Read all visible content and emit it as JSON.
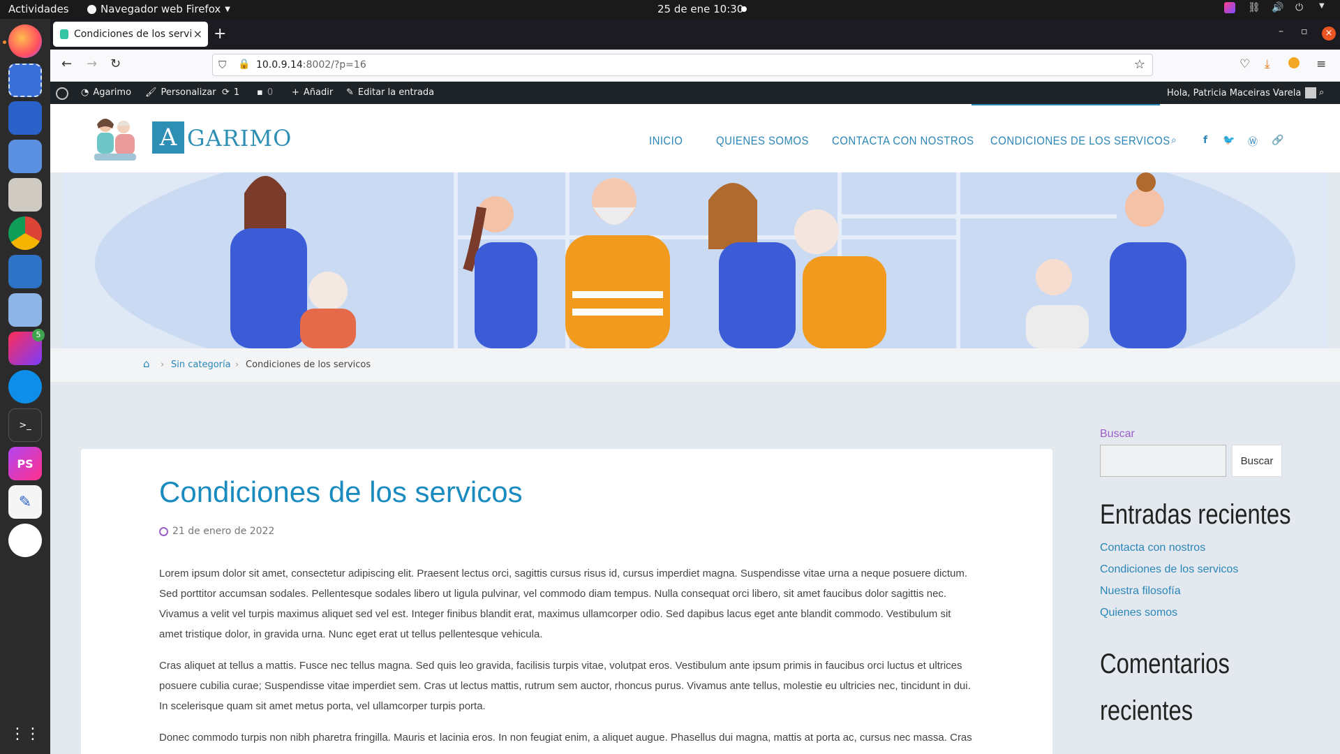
{
  "system": {
    "activities": "Actividades",
    "app_menu": "Navegador web Firefox",
    "clock": "25 de ene  10:30"
  },
  "dock": {
    "apps": [
      "firefox-icon",
      "screenshot-icon",
      "document-viewer-icon",
      "software-center-icon",
      "files-icon",
      "chrome-icon",
      "system-monitor-icon",
      "virtualbox-icon",
      "jetbrains-toolbox-icon",
      "teamviewer-icon",
      "terminal-icon",
      "phpstorm-icon",
      "text-editor-icon",
      "android-studio-icon",
      "show-apps-icon"
    ],
    "toolbox_badge": "5"
  },
  "browser": {
    "tab_title": "Condiciones de los servicos",
    "tab_close": "×",
    "new_tab": "+",
    "url_host": "10.0.9.14",
    "url_rest": ":8002/?p=16"
  },
  "wpbar": {
    "site_name": "Agarimo",
    "customize": "Personalizar",
    "updates": "1",
    "comments": "0",
    "add": "Añadir",
    "edit": "Editar la entrada",
    "greeting": "Hola, Patricia Maceiras Varela"
  },
  "site": {
    "logo_letter": "A",
    "logo_text": "GARIMO",
    "menu": [
      "INICIO",
      "QUIENES SOMOS",
      "CONTACTA CON NOSTROS",
      "CONDICIONES DE LOS SERVICOS"
    ]
  },
  "breadcrumb": {
    "category": "Sin categoría",
    "current": "Condiciones de los servicos",
    "sep": "›"
  },
  "post": {
    "title": "Condiciones de los servicos",
    "date": "21 de enero de 2022",
    "paragraphs": [
      "Lorem ipsum dolor sit amet, consectetur adipiscing elit. Praesent lectus orci, sagittis cursus risus id, cursus imperdiet magna. Suspendisse vitae urna a neque posuere dictum. Sed porttitor accumsan sodales. Pellentesque sodales libero ut ligula pulvinar, vel commodo diam tempus. Nulla consequat orci libero, sit amet faucibus dolor sagittis nec. Vivamus a velit vel turpis maximus aliquet sed vel est. Integer finibus blandit erat, maximus ullamcorper odio. Sed dapibus lacus eget ante blandit commodo. Vestibulum sit amet tristique dolor, in gravida urna. Nunc eget erat ut tellus pellentesque vehicula.",
      "Cras aliquet at tellus a mattis. Fusce nec tellus magna. Sed quis leo gravida, facilisis turpis vitae, volutpat eros. Vestibulum ante ipsum primis in faucibus orci luctus et ultrices posuere cubilia curae; Suspendisse vitae imperdiet sem. Cras ut lectus mattis, rutrum sem auctor, rhoncus purus. Vivamus ante tellus, molestie eu ultricies nec, tincidunt in dui. In scelerisque quam sit amet metus porta, vel ullamcorper turpis porta.",
      "Donec commodo turpis non nibh pharetra fringilla. Mauris et lacinia eros. In non feugiat enim, a aliquet augue. Phasellus dui magna, mattis at porta ac, cursus nec massa. Cras"
    ]
  },
  "sidebar": {
    "search_label": "Buscar",
    "search_button": "Buscar",
    "recent_title": "Entradas recientes",
    "recent": [
      "Contacta con nostros",
      "Condiciones de los servicos",
      "Nuestra filosofía",
      "Quienes somos"
    ],
    "comments_title_1": "Comentarios",
    "comments_title_2": "recientes"
  },
  "colors": {
    "accent": "#2a86b8",
    "title": "#1a8bbf",
    "search_label": "#9a5ec9"
  }
}
